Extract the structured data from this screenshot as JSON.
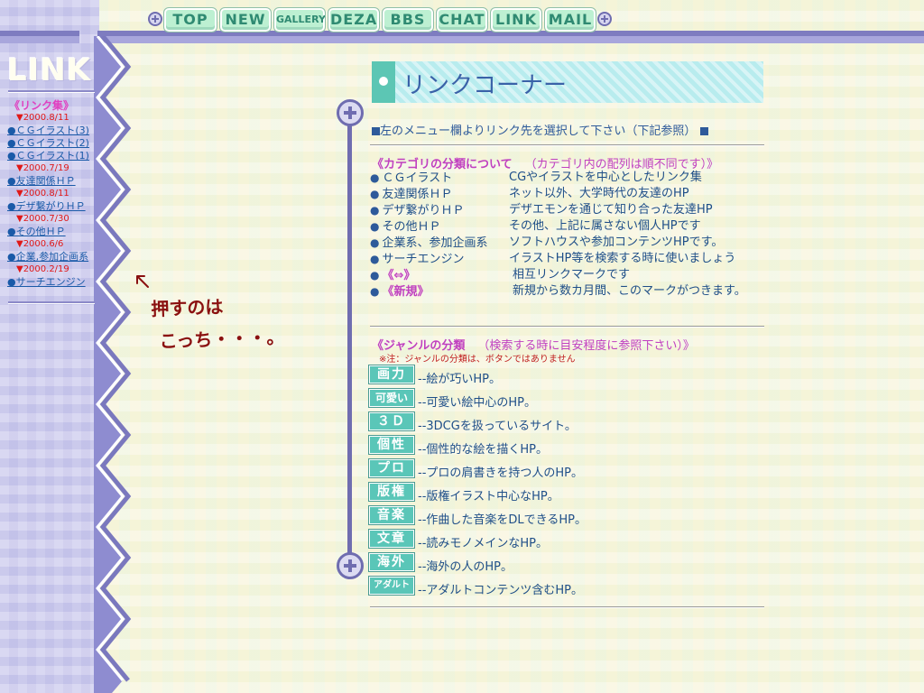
{
  "nav": {
    "items": [
      {
        "label": "TOP"
      },
      {
        "label": "NEW"
      },
      {
        "label": "GALLERY"
      },
      {
        "label": "DEZA"
      },
      {
        "label": "BBS"
      },
      {
        "label": "CHAT"
      },
      {
        "label": "LINK"
      },
      {
        "label": "MAIL"
      }
    ]
  },
  "sidebar": {
    "logo": "LINK",
    "heading": "《リンク集》",
    "entries": [
      {
        "date": "▼2000.8/11",
        "links": [
          "●ＣＧイラスト(3)",
          "●ＣＧイラスト(2)",
          "●ＣＧイラスト(1)"
        ]
      },
      {
        "date": "▼2000.7/19",
        "links": [
          "●友達関係ＨＰ"
        ]
      },
      {
        "date": "▼2000.8/11",
        "links": [
          "●デザ繋がりＨＰ"
        ]
      },
      {
        "date": "▼2000.7/30",
        "links": [
          "●その他ＨＰ"
        ]
      },
      {
        "date": "▼2000.6/6",
        "links": [
          "●企業,参加企画系"
        ]
      },
      {
        "date": "▼2000.2/19",
        "links": [
          "●サーチエンジン"
        ]
      }
    ]
  },
  "note": {
    "line1": "押すのは",
    "line2": "こっち・・・。"
  },
  "main": {
    "title": "リンクコーナー",
    "intro": "左のメニュー欄よりリンク先を選択して下さい（下記参照）",
    "category_head": "《カテゴリの分類について",
    "category_note": "（カテゴリ内の配列は順不同です）》",
    "categories": [
      {
        "label": "ＣＧイラスト",
        "desc": "CGやイラストを中心としたリンク集"
      },
      {
        "label": "友達関係ＨＰ",
        "desc": "ネット以外、大学時代の友達のHP"
      },
      {
        "label": "デザ繋がりＨＰ",
        "desc": "デザエモンを通じて知り合った友達HP"
      },
      {
        "label": "その他ＨＰ",
        "desc": "その他、上記に属さない個人HPです"
      },
      {
        "label": "企業系、参加企画系",
        "desc": "ソフトハウスや参加コンテンツHPです。"
      },
      {
        "label": "サーチエンジン",
        "desc": "イラストHP等を検索する時に使いましょう"
      },
      {
        "label": "《⇔》",
        "desc": "相互リンクマークです"
      },
      {
        "label": "《新規》",
        "desc": "新規から数カ月間、このマークがつきます。"
      }
    ],
    "genre_head": "《ジャンルの分類",
    "genre_note_head": "（検索する時に目安程度に参照下さい）》",
    "genre_note": "※注：ジャンルの分類は、ボタンではありません",
    "genres": [
      {
        "badge": "画力",
        "desc": "--絵が巧いHP。"
      },
      {
        "badge": "可愛い",
        "desc": "--可愛い絵中心のHP。"
      },
      {
        "badge": "３Ｄ",
        "desc": "--3DCGを扱っているサイト。"
      },
      {
        "badge": "個性",
        "desc": "--個性的な絵を描くHP。"
      },
      {
        "badge": "プロ",
        "desc": "--プロの肩書きを持つ人のHP。"
      },
      {
        "badge": "版権",
        "desc": "--版権イラスト中心なHP。"
      },
      {
        "badge": "音楽",
        "desc": "--作曲した音楽をDLできるHP。"
      },
      {
        "badge": "文章",
        "desc": "--読みモノメインなHP。"
      },
      {
        "badge": "海外",
        "desc": "--海外の人のHP。"
      },
      {
        "badge": "アダルト",
        "desc": "--アダルトコンテンツ含むHP。"
      }
    ]
  }
}
